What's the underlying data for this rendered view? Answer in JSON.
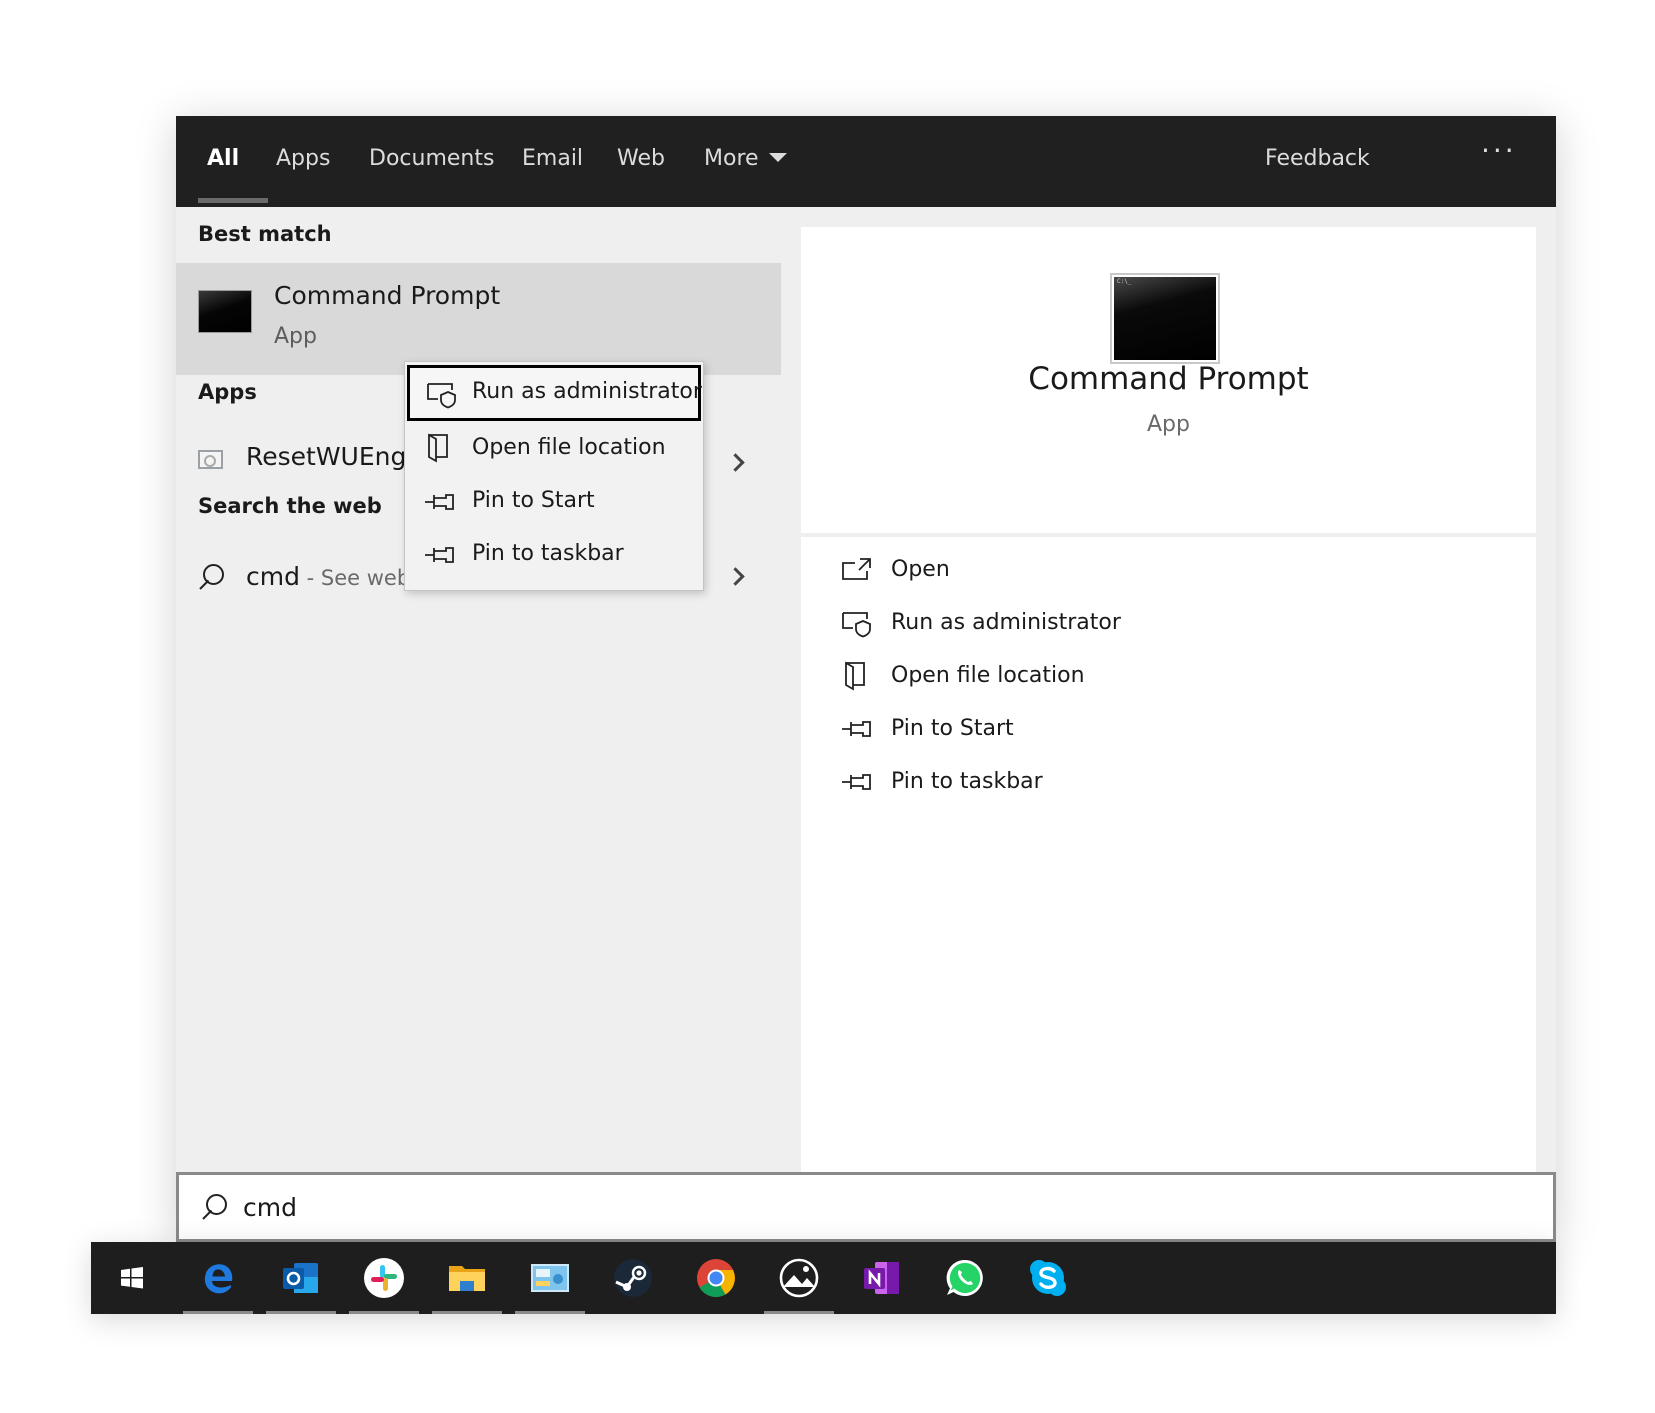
{
  "tabs": [
    {
      "label": "All",
      "active": true
    },
    {
      "label": "Apps"
    },
    {
      "label": "Documents"
    },
    {
      "label": "Email"
    },
    {
      "label": "Web"
    },
    {
      "label": "More"
    }
  ],
  "feedback_label": "Feedback",
  "more_options": "···",
  "best_match": {
    "heading": "Best match",
    "title": "Command Prompt",
    "subtitle": "App"
  },
  "apps": {
    "heading": "Apps",
    "items": [
      {
        "label": "ResetWUEng.cmd"
      }
    ]
  },
  "web": {
    "heading": "Search the web",
    "query": "cmd",
    "hint": " - See web results"
  },
  "context_menu": {
    "items": [
      {
        "label": "Run as administrator",
        "icon": "shield-icon"
      },
      {
        "label": "Open file location",
        "icon": "folder-location-icon"
      },
      {
        "label": "Pin to Start",
        "icon": "pin-icon"
      },
      {
        "label": "Pin to taskbar",
        "icon": "pin-icon"
      }
    ]
  },
  "preview": {
    "title": "Command Prompt",
    "subtitle": "App",
    "actions": [
      {
        "label": "Open",
        "icon": "open-icon"
      },
      {
        "label": "Run as administrator",
        "icon": "shield-icon"
      },
      {
        "label": "Open file location",
        "icon": "folder-location-icon"
      },
      {
        "label": "Pin to Start",
        "icon": "pin-icon"
      },
      {
        "label": "Pin to taskbar",
        "icon": "pin-icon"
      }
    ]
  },
  "search": {
    "value": "cmd"
  },
  "taskbar": {
    "apps": [
      {
        "name": "Start",
        "icon": "windows-icon"
      },
      {
        "name": "Microsoft Edge",
        "icon": "edge-icon",
        "running": true
      },
      {
        "name": "Outlook",
        "icon": "outlook-icon",
        "running": true
      },
      {
        "name": "Slack",
        "icon": "slack-icon",
        "running": true
      },
      {
        "name": "File Explorer",
        "icon": "file-explorer-icon",
        "running": true
      },
      {
        "name": "Control Panel",
        "icon": "control-panel-icon",
        "running": true
      },
      {
        "name": "Steam",
        "icon": "steam-icon"
      },
      {
        "name": "Google Chrome",
        "icon": "chrome-icon"
      },
      {
        "name": "Xbox",
        "icon": "xbox-icon",
        "running": true
      },
      {
        "name": "OneNote",
        "icon": "onenote-icon"
      },
      {
        "name": "WhatsApp",
        "icon": "whatsapp-icon"
      },
      {
        "name": "Skype",
        "icon": "skype-icon"
      }
    ]
  },
  "colors": {
    "topbar": "#202020",
    "panel": "#efefef",
    "highlight": "#d9d9d9",
    "taskbar": "#1e1e1e"
  }
}
